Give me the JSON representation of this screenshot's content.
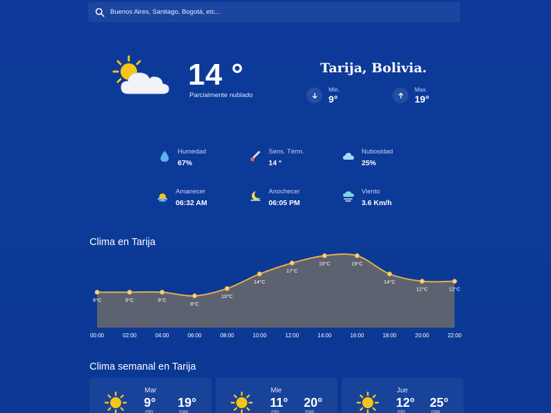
{
  "search": {
    "placeholder": "Buenos Aires, Santiago, Bogotá, etc..."
  },
  "current": {
    "temperature": "14 °",
    "condition": "Parcialmente nublado",
    "city": "Tarija, Bolivia.",
    "min_label": "Min.",
    "min_value": "9°",
    "max_label": "Max.",
    "max_value": "19°",
    "icon": "partly-cloudy-icon"
  },
  "stats": [
    {
      "label": "Humedad",
      "value": "67%",
      "icon": "humidity-drop-icon"
    },
    {
      "label": "Sens. Térm.",
      "value": "14 °",
      "icon": "thermometer-icon"
    },
    {
      "label": "Nubosidad",
      "value": "25%",
      "icon": "cloud-icon"
    },
    {
      "label": "Amanecer",
      "value": "06:32 AM",
      "icon": "sunrise-icon"
    },
    {
      "label": "Anochecer",
      "value": "06:05 PM",
      "icon": "moon-icon"
    },
    {
      "label": "Viento",
      "value": "3.6 Km/h",
      "icon": "wind-icon"
    }
  ],
  "hourly": {
    "title": "Clima en Tarija"
  },
  "chart_data": {
    "type": "area",
    "categories": [
      "00:00",
      "02:00",
      "04:00",
      "06:00",
      "08:00",
      "10:00",
      "12:00",
      "14:00",
      "16:00",
      "18:00",
      "20:00",
      "22:00"
    ],
    "values": [
      9,
      9,
      9,
      8,
      10,
      14,
      17,
      19,
      19,
      14,
      12,
      12
    ],
    "data_labels": [
      "9°C",
      "9°C",
      "9°C",
      "8°C",
      "10°C",
      "14°C",
      "17°C",
      "19°C",
      "19°C",
      "14°C",
      "12°C",
      "12°C"
    ],
    "title": "",
    "xlabel": "",
    "ylabel": "",
    "grid": false,
    "colors": {
      "line": "#e8b04a",
      "fill": "#5d6270"
    }
  },
  "weekly": {
    "title": "Clima semanal en Tarija",
    "days": [
      {
        "day": "Mar",
        "min": "9°",
        "max": "19°",
        "min_label": "min",
        "max_label": "max",
        "icon": "sun-icon"
      },
      {
        "day": "Mie",
        "min": "11°",
        "max": "20°",
        "min_label": "min",
        "max_label": "max",
        "icon": "sun-icon"
      },
      {
        "day": "Jue",
        "min": "12°",
        "max": "25°",
        "min_label": "min",
        "max_label": "max",
        "icon": "sun-icon"
      }
    ]
  },
  "colors": {
    "background": "#0c3a98",
    "sun": "#f5c518",
    "accent_line": "#e8b04a"
  }
}
